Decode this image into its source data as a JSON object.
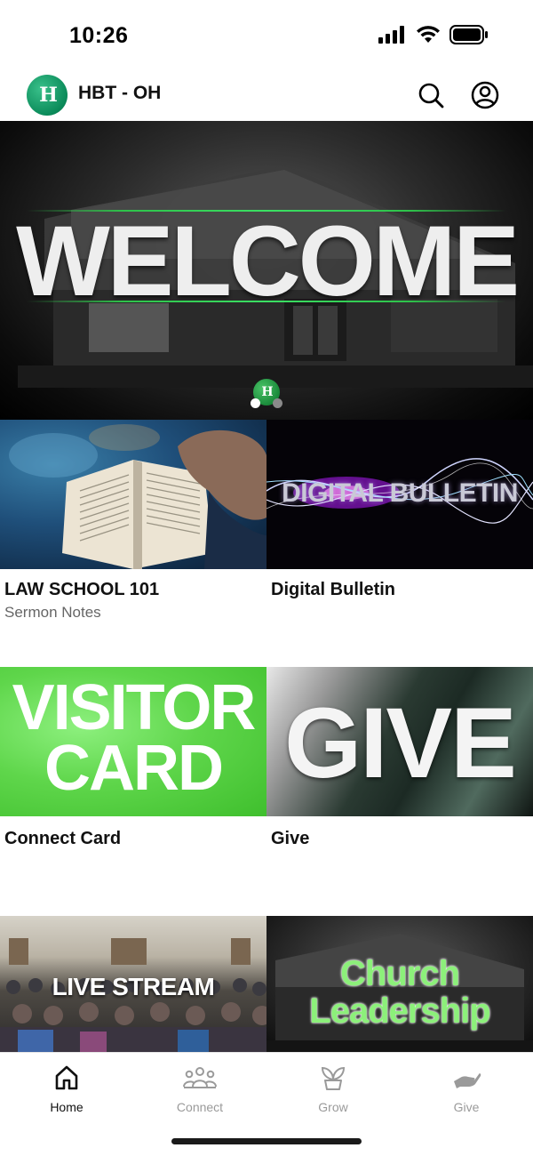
{
  "status_bar": {
    "time": "10:26",
    "signal_icon": "cellular-signal-icon",
    "wifi_icon": "wifi-icon",
    "battery_icon": "battery-icon"
  },
  "header": {
    "logo_text": "H",
    "title": "HBT - OH",
    "search_icon": "search-icon",
    "profile_icon": "profile-icon"
  },
  "hero": {
    "title": "WELCOME",
    "mini_logo_text": "H",
    "active_slide": 1,
    "slide_count": 2
  },
  "tiles": [
    {
      "title": "LAW SCHOOL 101",
      "subtitle": "Sermon Notes",
      "image_text": ""
    },
    {
      "title": "Digital Bulletin",
      "subtitle": "",
      "image_text": "DIGITAL BULLETIN"
    },
    {
      "title": "Connect Card",
      "subtitle": "",
      "image_text_line1": "VISITOR",
      "image_text_line2": "CARD"
    },
    {
      "title": "Give",
      "subtitle": "",
      "image_text": "GIVE"
    },
    {
      "title": "",
      "subtitle": "",
      "image_text": "LIVE STREAM"
    },
    {
      "title": "",
      "subtitle": "",
      "image_text_line1": "Church",
      "image_text_line2": "Leadership"
    }
  ],
  "tab_bar": {
    "active": "Home",
    "tabs": [
      {
        "label": "Home",
        "icon": "home-icon"
      },
      {
        "label": "Connect",
        "icon": "people-icon"
      },
      {
        "label": "Grow",
        "icon": "sprout-icon"
      },
      {
        "label": "Give",
        "icon": "hand-icon"
      }
    ]
  },
  "colors": {
    "brand_green": "#0b8b5a",
    "accent_green": "#5fd64b",
    "inactive_tab": "#9a9a9a"
  }
}
